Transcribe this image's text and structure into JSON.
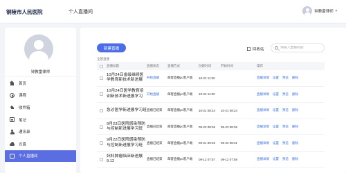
{
  "header": {
    "logo": "铜陵市人民医院",
    "page_title": "个人直播间",
    "user_name": "钟教雷律师",
    "caret": "▾"
  },
  "sidebar": {
    "profile_name": "钟教雷律师",
    "items": [
      {
        "label": "首页",
        "icon": "home-icon"
      },
      {
        "label": "课程",
        "icon": "course-icon"
      },
      {
        "label": "收件箱",
        "icon": "graduation-cap-icon"
      },
      {
        "label": "笔记",
        "icon": "note-icon"
      },
      {
        "label": "通讯录",
        "icon": "contacts-icon"
      },
      {
        "label": "云盘",
        "icon": "cloud-icon"
      },
      {
        "label": "个人直播间",
        "icon": "live-icon",
        "active": true
      }
    ]
  },
  "main": {
    "new_button": "新建直播",
    "recycle_bin": "回收站",
    "search_placeholder": "请输入直播标题",
    "count_label": "全部直播",
    "table": {
      "headers": [
        "直播标题",
        "直播状态",
        "直播方式",
        "创建时间",
        "开始时间",
        "操作"
      ],
      "rows": [
        {
          "title": "10月24日省级继续医学教育新技术新进展",
          "status": "开始直播",
          "status_type": "live",
          "method": "邮客直播pc客户端",
          "created": "10-22 11:00",
          "start": "",
          "ops": [
            "直播详情",
            "设置",
            "预览",
            "删除"
          ]
        },
        {
          "title": "10月24日医学教育培训新技术新进展学习",
          "status": "开始直播",
          "status_type": "live",
          "method": "邮客直播pc客户端",
          "created": "10-22 11:00",
          "start": "",
          "ops": [
            "直播详情",
            "设置",
            "预览",
            "删除"
          ]
        },
        {
          "title": "急诊医学新进展学习班",
          "status": "直播已结束",
          "status_type": "ended",
          "method": "邮客直播pc客户端",
          "created": "10-21 08:24",
          "start": "10-21 08:24",
          "ops": [
            "直播详情",
            "设置",
            "预览",
            "删除"
          ]
        },
        {
          "title": "9月23日医院感染预防与控制新进展学习班",
          "status": "直播已结束",
          "status_type": "ended",
          "method": "邮客直播pc客户端",
          "created": "09-23 08:36",
          "start": "09-23 08:36",
          "ops": [
            "直播详情",
            "设置",
            "预览",
            "删除"
          ]
        },
        {
          "title": "9月22日医院感染预防与控制新进展学习班",
          "status": "直播已结束",
          "status_type": "ended",
          "method": "邮客直播pc客户端",
          "created": "09-21 09:33",
          "start": "09-22 08:31",
          "ops": [
            "直播详情",
            "设置",
            "预览",
            "删除"
          ]
        },
        {
          "title": "妇科肿瘤临床新进展9.12",
          "status": "直播已结束",
          "status_type": "ended",
          "method": "邮客直播pc客户端",
          "created": "09-12 07:57",
          "start": "09-12 07:58",
          "ops": [
            "直播详情",
            "设置",
            "预览",
            "删除"
          ]
        }
      ]
    }
  },
  "colors": {
    "accent": "#4d6ce8",
    "active_menu": "#5b6ee1",
    "link": "#3b6fe0"
  }
}
